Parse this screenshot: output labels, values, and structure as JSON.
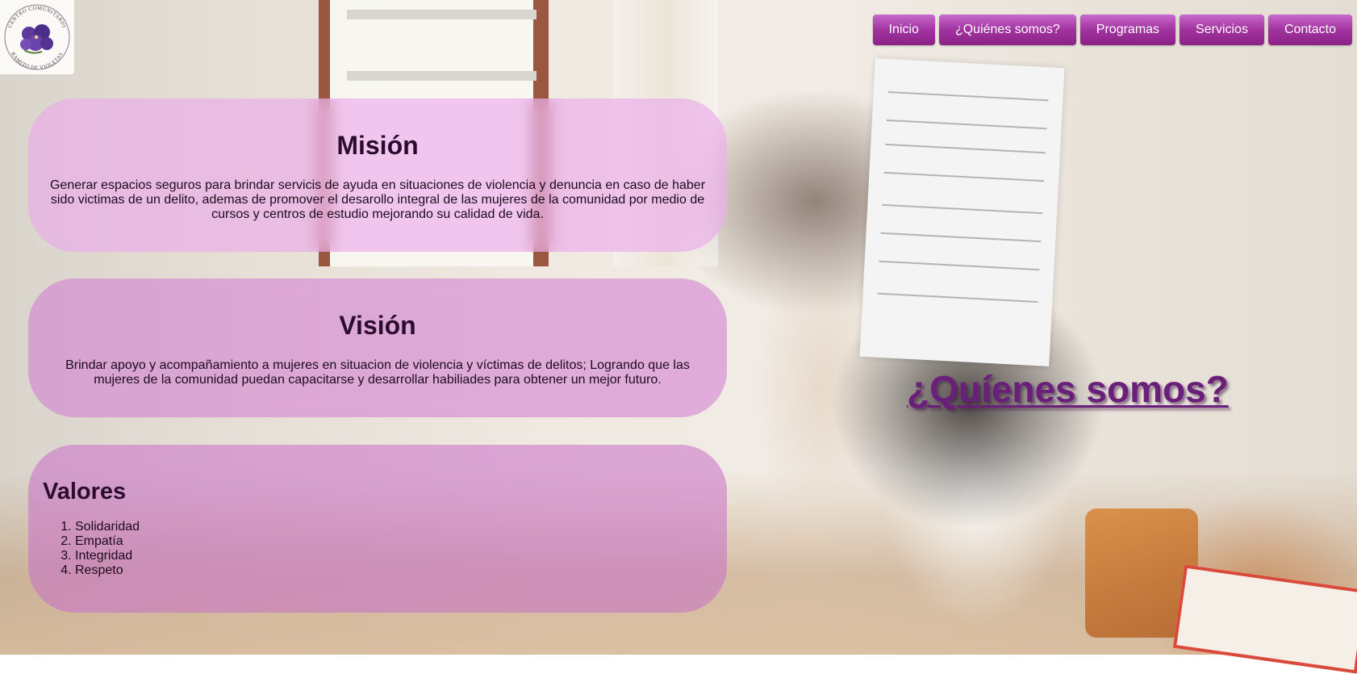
{
  "logo": {
    "alt": "Centro Comunitario Ramito de Violetas",
    "arc_top": "CENTRO COMUNITARIO",
    "arc_bottom": "RAMITO DE VIOLETAS"
  },
  "nav": {
    "items": [
      {
        "label": "Inicio"
      },
      {
        "label": "¿Quiénes somos?"
      },
      {
        "label": "Programas"
      },
      {
        "label": "Servicios"
      },
      {
        "label": "Contacto"
      }
    ]
  },
  "mision": {
    "title": "Misión",
    "text": "Generar espacios seguros para brindar servicis de ayuda en situaciones de violencia y denuncia en caso de haber sido victimas de un delito, ademas de promover el desarollo integral de las mujeres de la comunidad por medio de cursos y centros de estudio mejorando su calidad de vida."
  },
  "vision": {
    "title": "Visión",
    "text": "Brindar apoyo y acompañamiento a mujeres en situacion de violencia y víctimas de delitos; Logrando que las mujeres de la comunidad puedan capacitarse y desarrollar habiliades para obtener un mejor futuro."
  },
  "valores": {
    "title": "Valores",
    "items": [
      "Solidaridad",
      "Empatía",
      "Integridad",
      "Respeto"
    ]
  },
  "headline": "¿Quíenes somos?",
  "colors": {
    "nav_button": "#a2339f",
    "headline": "#6a1f7a",
    "card_tint": "#e182e1"
  }
}
